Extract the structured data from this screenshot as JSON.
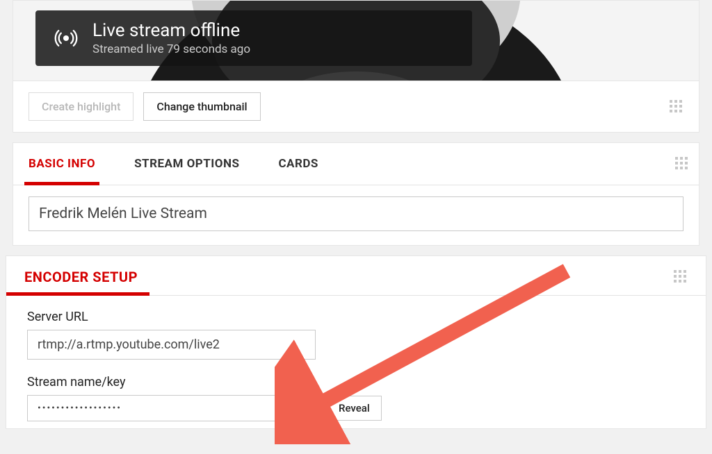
{
  "stream_status": {
    "title": "Live stream offline",
    "subtitle": "Streamed live 79 seconds ago"
  },
  "toolbar": {
    "create_highlight": "Create highlight",
    "change_thumbnail": "Change thumbnail"
  },
  "tabs": {
    "basic_info": "BASIC INFO",
    "stream_options": "STREAM OPTIONS",
    "cards": "CARDS"
  },
  "stream_title": "Fredrik Melén Live Stream",
  "encoder": {
    "heading": "ENCODER SETUP",
    "server_url_label": "Server URL",
    "server_url_value": "rtmp://a.rtmp.youtube.com/live2",
    "stream_key_label": "Stream name/key",
    "stream_key_masked": "••••••••••••••••••",
    "reveal": "Reveal"
  }
}
